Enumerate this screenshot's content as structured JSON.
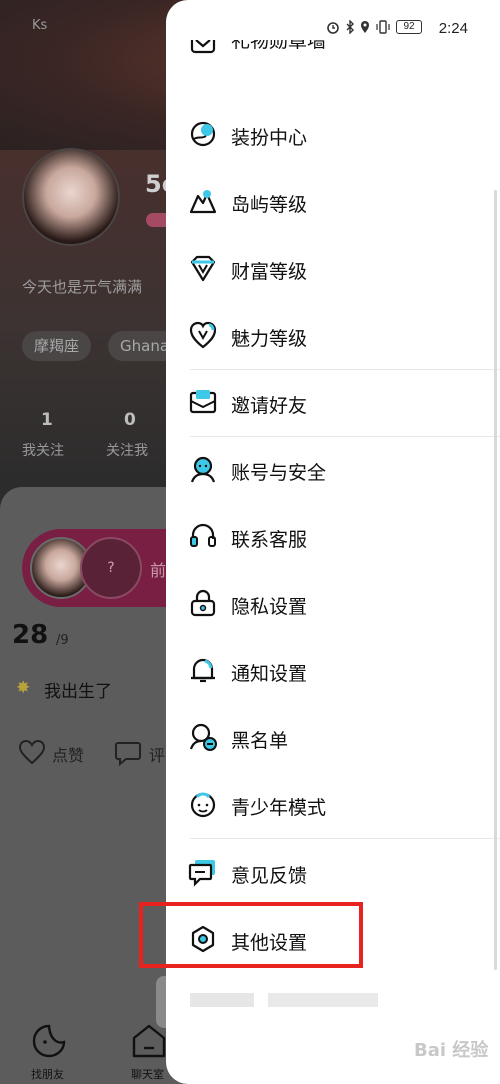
{
  "status_bar": {
    "left_text": "Ks",
    "battery": "92",
    "time": "2:24"
  },
  "profile": {
    "name_partial": "5c",
    "signature": "今天也是元气满满",
    "tags": [
      "摩羯座",
      "Ghana"
    ],
    "stats": [
      {
        "value": "1",
        "label": "我关注"
      },
      {
        "value": "0",
        "label": "关注我"
      }
    ]
  },
  "feed": {
    "pill_question": "?",
    "pill_text": "前",
    "day": "28",
    "day_total": "/9",
    "post_text": "我出生了",
    "like_label": "点赞",
    "comment_label": "评"
  },
  "bottom_nav": [
    {
      "label": "找朋友"
    },
    {
      "label": "聊天室"
    }
  ],
  "drawer": {
    "partial_top_item": "礼物勋章墙",
    "menu_items": [
      {
        "label": "装扮中心",
        "icon": "dress-up-icon"
      },
      {
        "label": "岛屿等级",
        "icon": "island-level-icon"
      },
      {
        "label": "财富等级",
        "icon": "wealth-level-icon"
      },
      {
        "label": "魅力等级",
        "icon": "charm-level-icon"
      },
      {
        "label": "邀请好友",
        "icon": "invite-friends-icon"
      },
      {
        "label": "账号与安全",
        "icon": "account-security-icon"
      },
      {
        "label": "联系客服",
        "icon": "headset-icon"
      },
      {
        "label": "隐私设置",
        "icon": "lock-icon"
      },
      {
        "label": "通知设置",
        "icon": "bell-icon"
      },
      {
        "label": "黑名单",
        "icon": "blacklist-icon"
      },
      {
        "label": "青少年模式",
        "icon": "teen-mode-icon"
      },
      {
        "label": "意见反馈",
        "icon": "feedback-icon"
      },
      {
        "label": "其他设置",
        "icon": "hexagon-settings-icon"
      }
    ]
  },
  "colors": {
    "accent_cyan": "#3ec8e8",
    "highlight_red": "#e8231f",
    "pill_magenta": "#7a1f44"
  },
  "watermark": "Bai 经验"
}
